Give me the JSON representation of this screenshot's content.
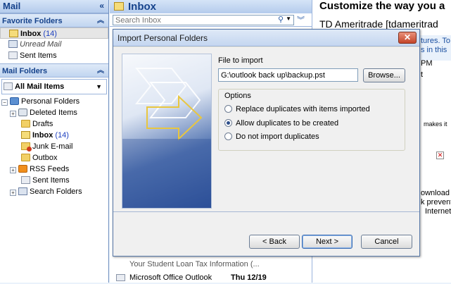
{
  "nav": {
    "title": "Mail",
    "collapse_glyph": "«",
    "favorites_header": "Favorite Folders",
    "favorites": [
      {
        "label": "Inbox",
        "count": "(14)",
        "icon": "inbox-icon"
      },
      {
        "label": "Unread Mail",
        "icon": "search-folder-icon"
      },
      {
        "label": "Sent Items",
        "icon": "sent-items-icon"
      }
    ],
    "mail_folders_header": "Mail Folders",
    "all_mail_label": "All Mail Items",
    "tree_root": "Personal Folders",
    "tree": [
      {
        "label": "Deleted Items",
        "icon": "deleted-items-icon"
      },
      {
        "label": "Drafts",
        "icon": "drafts-icon"
      },
      {
        "label": "Inbox",
        "count": "(14)",
        "icon": "inbox-icon"
      },
      {
        "label": "Junk E-mail",
        "icon": "junk-email-icon"
      },
      {
        "label": "Outbox",
        "icon": "outbox-icon"
      },
      {
        "label": "RSS Feeds",
        "icon": "rss-icon"
      },
      {
        "label": "Sent Items",
        "icon": "sent-items-icon"
      },
      {
        "label": "Search Folders",
        "icon": "search-folder-icon"
      }
    ]
  },
  "inbox": {
    "title": "Inbox",
    "search_placeholder": "Search Inbox",
    "messages": [
      {
        "sender": "Your Student Loan Tax Information (...",
        "date": ""
      },
      {
        "sender": "Microsoft Office Outlook",
        "date": "Thu 12/19"
      }
    ]
  },
  "reading": {
    "subject": "Customize the way you a",
    "from": "TD Ameritrade [tdameritrad",
    "fragments": {
      "f1": "tures. To",
      "f2": "s in this",
      "f3": "PM",
      "f4": "t",
      "f5": "makes it",
      "f6": "ownload p",
      "f7": "k prevent",
      "f8": "Internet."
    }
  },
  "dialog": {
    "title": "Import Personal Folders",
    "close_label": "✕",
    "file_label": "File to import",
    "file_value": "G:\\outlook back up\\backup.pst",
    "browse_label": "Browse...",
    "options_label": "Options",
    "options": [
      {
        "label": "Replace duplicates with items imported",
        "selected": false
      },
      {
        "label": "Allow duplicates to be created",
        "selected": true
      },
      {
        "label": "Do not import duplicates",
        "selected": false
      }
    ],
    "back_label": "< Back",
    "next_label": "Next >",
    "cancel_label": "Cancel"
  }
}
